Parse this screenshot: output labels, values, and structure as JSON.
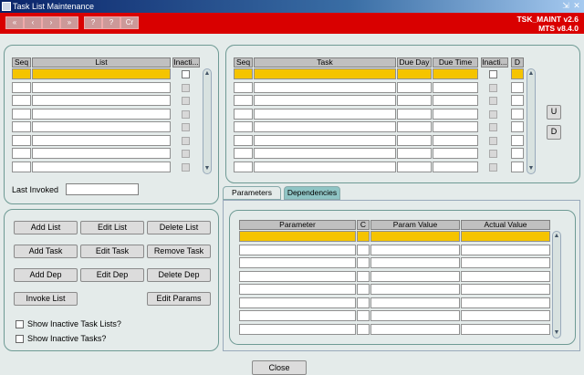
{
  "window": {
    "title": "Task List Maintenance"
  },
  "toolbar": {
    "buttons": [
      "«",
      "‹",
      "›",
      "»",
      "?",
      "?",
      "Cr"
    ],
    "app_line1": "TSK_MAINT v2.6",
    "app_line2": "MTS v8.4.0"
  },
  "list_grid": {
    "headers": [
      "Seq",
      "List",
      "Inacti..."
    ],
    "row_count": 8
  },
  "last_invoked": {
    "label": "Last Invoked",
    "value": ""
  },
  "task_grid": {
    "headers": [
      "Seq",
      "Task",
      "Due Day",
      "Due Time",
      "Inacti...",
      "D"
    ],
    "row_count": 8
  },
  "side_buttons": {
    "up": "U",
    "down": "D"
  },
  "tabs": {
    "parameters": "Parameters",
    "dependencies": "Dependencies"
  },
  "param_grid": {
    "headers": [
      "Parameter",
      "C",
      "Param Value",
      "Actual Value"
    ],
    "row_count": 8
  },
  "actions": {
    "add_list": "Add List",
    "edit_list": "Edit List",
    "delete_list": "Delete List",
    "add_task": "Add Task",
    "edit_task": "Edit Task",
    "remove_task": "Remove Task",
    "add_dep": "Add Dep",
    "edit_dep": "Edit Dep",
    "delete_dep": "Delete Dep",
    "invoke_list": "Invoke List",
    "edit_params": "Edit Params"
  },
  "options": {
    "show_inactive_lists": "Show Inactive Task Lists?",
    "show_inactive_tasks": "Show Inactive Tasks?"
  },
  "close": "Close"
}
